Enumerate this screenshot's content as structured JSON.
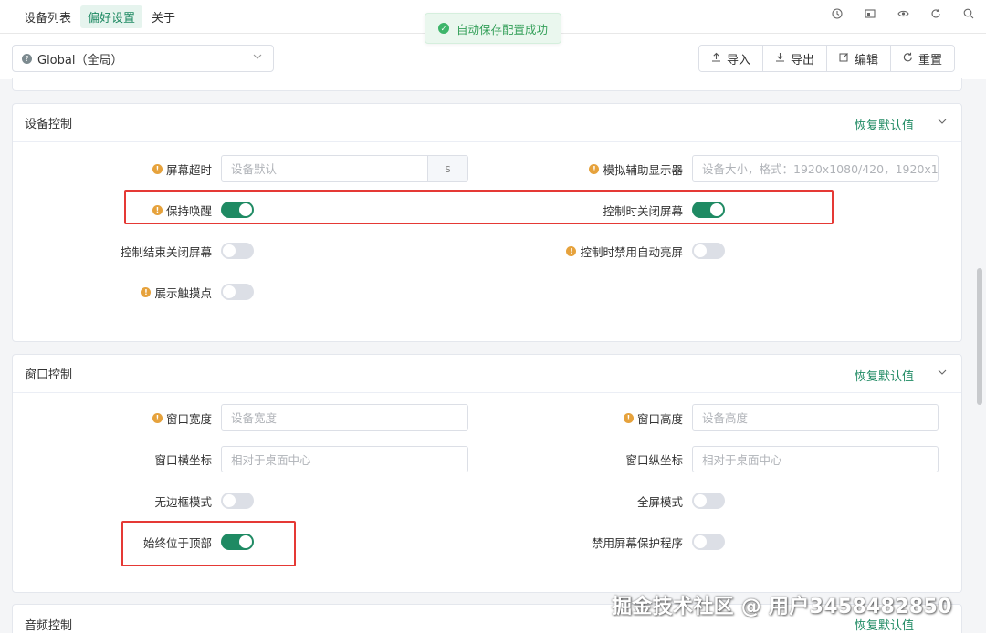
{
  "nav": {
    "tabs": [
      {
        "label": "设备列表"
      },
      {
        "label": "偏好设置"
      },
      {
        "label": "关于"
      }
    ],
    "icons": [
      "clock-icon",
      "screen-icon",
      "eye-icon",
      "refresh-icon",
      "search-icon"
    ]
  },
  "toast": {
    "message": "自动保存配置成功"
  },
  "toolbar": {
    "scope_value": "Global（全局）",
    "import_label": "导入",
    "export_label": "导出",
    "edit_label": "编辑",
    "reset_label": "重置"
  },
  "device_control": {
    "title": "设备控制",
    "reset_default": "恢复默认值",
    "screen_timeout_label": "屏幕超时",
    "screen_timeout_placeholder": "设备默认",
    "screen_timeout_unit": "s",
    "virtual_display_label": "模拟辅助显示器",
    "virtual_display_placeholder": "设备大小，格式：1920x1080/420，1920x1",
    "stay_awake_label": "保持唤醒",
    "stay_awake": true,
    "turn_screen_off_label": "控制时关闭屏幕",
    "turn_screen_off": true,
    "power_off_on_close_label": "控制结束关闭屏幕",
    "power_off_on_close": false,
    "disable_auto_brightness_label": "控制时禁用自动亮屏",
    "disable_auto_brightness": false,
    "show_touches_label": "展示触摸点",
    "show_touches": false
  },
  "window_control": {
    "title": "窗口控制",
    "reset_default": "恢复默认值",
    "width_label": "窗口宽度",
    "width_placeholder": "设备宽度",
    "height_label": "窗口高度",
    "height_placeholder": "设备高度",
    "x_label": "窗口横坐标",
    "x_placeholder": "相对于桌面中心",
    "y_label": "窗口纵坐标",
    "y_placeholder": "相对于桌面中心",
    "borderless_label": "无边框模式",
    "borderless": false,
    "fullscreen_label": "全屏模式",
    "fullscreen": false,
    "always_on_top_label": "始终位于顶部",
    "always_on_top": true,
    "disable_screensaver_label": "禁用屏幕保护程序",
    "disable_screensaver": false
  },
  "next_section": {
    "title": "音频控制",
    "reset_default": "恢复默认值"
  },
  "watermark": "掘金技术社区 @ 用户3458482850"
}
